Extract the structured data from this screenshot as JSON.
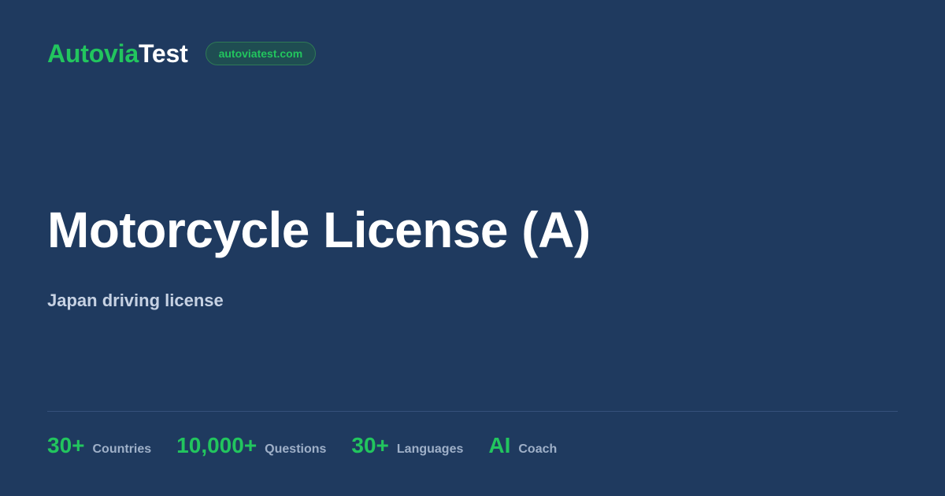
{
  "header": {
    "brand_part1": "Autovia",
    "brand_part2": "Test",
    "url_badge": "autoviatest.com"
  },
  "main": {
    "title": "Motorcycle License (A)",
    "subtitle": "Japan driving license"
  },
  "stats": [
    {
      "value": "30+",
      "label": "Countries"
    },
    {
      "value": "10,000+",
      "label": "Questions"
    },
    {
      "value": "30+",
      "label": "Languages"
    },
    {
      "value": "AI",
      "label": "Coach"
    }
  ],
  "colors": {
    "background": "#1f3a5f",
    "accent": "#22c55e",
    "title": "#ffffff",
    "subtitle": "#c7d2e3",
    "stat_label": "#9fb0c8"
  }
}
